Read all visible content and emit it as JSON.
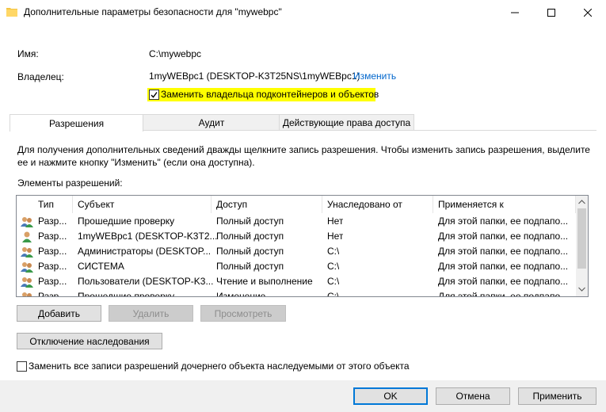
{
  "window": {
    "title": "Дополнительные параметры безопасности  для \"mywebpc\""
  },
  "info": {
    "name_label": "Имя:",
    "name_value": "C:\\mywebpc",
    "owner_label": "Владелец:",
    "owner_value": "1myWEBpc1 (DESKTOP-K3T25NS\\1myWEBpc1)",
    "change_link": "Изменить",
    "replace_owner_label": "Заменить владельца подконтейнеров и объектов",
    "replace_owner_checked": true
  },
  "tabs": [
    {
      "label": "Разрешения",
      "active": true
    },
    {
      "label": "Аудит",
      "active": false
    },
    {
      "label": "Действующие права доступа",
      "active": false
    }
  ],
  "permissions": {
    "hint": "Для получения дополнительных сведений дважды щелкните запись разрешения. Чтобы изменить запись разрешения, выделите ее и нажмите кнопку \"Изменить\" (если она доступна).",
    "hint_line1": "Для получения дополнительных сведений дважды щелкните запись разрешения. Чтобы изменить запись разрешения, выделите",
    "hint_line2": "ее и нажмите кнопку \"Изменить\" (если она доступна).",
    "list_label": "Элементы разрешений:",
    "columns": [
      "Тип",
      "Субъект",
      "Доступ",
      "Унаследовано от",
      "Применяется к"
    ],
    "rows": [
      {
        "icon": "group-icon",
        "type": "Разр...",
        "subject": "Прошедшие проверку",
        "access": "Полный доступ",
        "inherited": "Нет",
        "applies": "Для этой папки, ее подпапо..."
      },
      {
        "icon": "user-icon",
        "type": "Разр...",
        "subject": "1myWEBpc1 (DESKTOP-K3T2...",
        "access": "Полный доступ",
        "inherited": "Нет",
        "applies": "Для этой папки, ее подпапо..."
      },
      {
        "icon": "group-icon",
        "type": "Разр...",
        "subject": "Администраторы (DESKTOP...",
        "access": "Полный доступ",
        "inherited": "C:\\",
        "applies": "Для этой папки, ее подпапо..."
      },
      {
        "icon": "group-icon",
        "type": "Разр...",
        "subject": "СИСТЕМА",
        "access": "Полный доступ",
        "inherited": "C:\\",
        "applies": "Для этой папки, ее подпапо..."
      },
      {
        "icon": "group-icon",
        "type": "Разр...",
        "subject": "Пользователи (DESKTOP-K3...",
        "access": "Чтение и выполнение",
        "inherited": "C:\\",
        "applies": "Для этой папки, ее подпапо..."
      },
      {
        "icon": "group-icon",
        "type": "Разр...",
        "subject": "Прошедшие проверку",
        "access": "Изменение",
        "inherited": "C:\\",
        "applies": "Для этой папки, ее подпапо..."
      }
    ]
  },
  "buttons": {
    "add": "Добавить",
    "remove": "Удалить",
    "view": "Просмотреть",
    "disable_inheritance": "Отключение наследования",
    "ok": "OK",
    "cancel": "Отмена",
    "apply": "Применить"
  },
  "replace_all": {
    "label": "Заменить все записи разрешений дочернего объекта наследуемыми от этого объекта",
    "checked": false
  },
  "colors": {
    "highlight": "#ffff00",
    "link": "#0066cc",
    "default_button_border": "#0078d7"
  }
}
